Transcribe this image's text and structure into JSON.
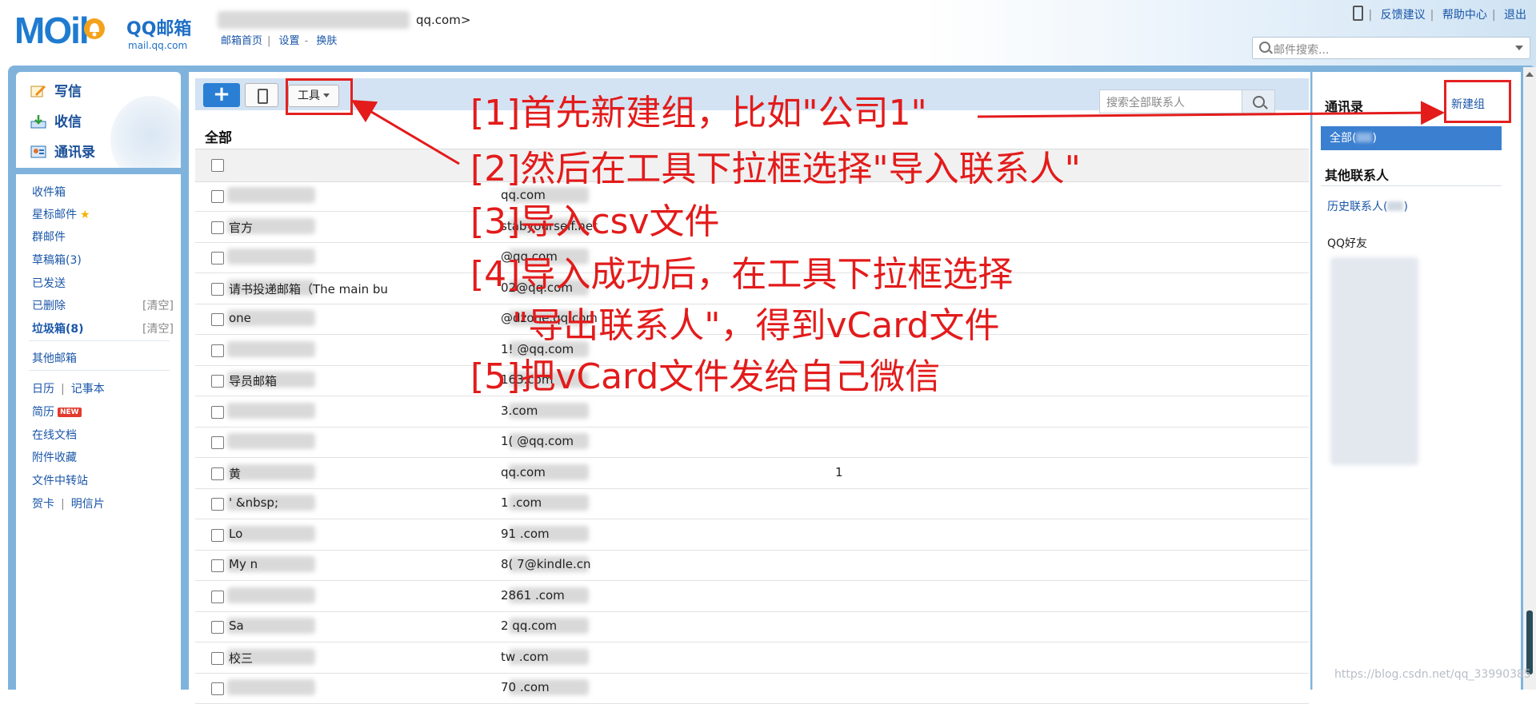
{
  "header": {
    "logo_text": "MOil",
    "brand": "QQ邮箱",
    "brand_url": "mail.qq.com",
    "account_suffix": "qq.com>",
    "links": [
      "邮箱首页",
      "设置",
      "换肤"
    ],
    "right_links": [
      "反馈建议",
      "帮助中心",
      "退出"
    ],
    "mail_search_placeholder": "邮件搜索..."
  },
  "quick_actions": [
    {
      "label": "写信",
      "icon": "compose-icon"
    },
    {
      "label": "收信",
      "icon": "inbox-download-icon"
    },
    {
      "label": "通讯录",
      "icon": "contacts-card-icon"
    }
  ],
  "folders": {
    "inbox": "收件箱",
    "starred": "星标邮件",
    "group": "群邮件",
    "drafts": "草稿箱(3)",
    "sent": "已发送",
    "deleted": "已删除",
    "deleted_clear": "[清空]",
    "spam": "垃圾箱(8)",
    "spam_clear": "[清空]",
    "other": "其他邮箱",
    "calendar": "日历",
    "notes": "记事本",
    "resume": "简历",
    "new_badge": "NEW",
    "docs": "在线文档",
    "attachments": "附件收藏",
    "transfer": "文件中转站",
    "cards": "贺卡",
    "postcards": "明信片"
  },
  "toolbar": {
    "add": "+",
    "tools": "工具",
    "contact_search_placeholder": "搜索全部联系人"
  },
  "list": {
    "title": "全部",
    "rows": [
      {
        "name": "",
        "email": "qq.com",
        "extra": ""
      },
      {
        "name": "官方",
        "email": "stabyourself.net",
        "extra": ""
      },
      {
        "name": "",
        "email": "@qq.com",
        "extra": ""
      },
      {
        "name": "请书投递邮箱（The main bu",
        "email": "02@qq.com",
        "extra": ""
      },
      {
        "name": "one",
        "email": "@dzone.qq.com",
        "extra": ""
      },
      {
        "name": "",
        "email": "1!              @qq.com",
        "extra": ""
      },
      {
        "name": "导员邮箱",
        "email": "163.com",
        "extra": ""
      },
      {
        "name": "",
        "email": "3.com",
        "extra": ""
      },
      {
        "name": "",
        "email": "1(              @qq.com",
        "extra": ""
      },
      {
        "name": "黄",
        "email": "qq.com",
        "extra": "1"
      },
      {
        "name": "'                     &nbsp;",
        "email": "1               .com",
        "extra": ""
      },
      {
        "name": "Lo",
        "email": "91              .com",
        "extra": ""
      },
      {
        "name": "My                  n",
        "email": "8(              7@kindle.cn",
        "extra": ""
      },
      {
        "name": "",
        "email": "2861            .com",
        "extra": ""
      },
      {
        "name": "Sa",
        "email": "2               qq.com",
        "extra": ""
      },
      {
        "name": "校三",
        "email": "tw              .com",
        "extra": ""
      },
      {
        "name": "",
        "email": "70              .com",
        "extra": ""
      }
    ]
  },
  "contacts_panel": {
    "title": "通讯录",
    "new_group": "新建组",
    "all": "全部(",
    "all_suffix": ")",
    "other_contacts": "其他联系人",
    "history": "历史联系人(",
    "history_suffix": ")",
    "qq_friends": "QQ好友"
  },
  "annotations": [
    "[1]首先新建组，比如\"公司1\"",
    "[2]然后在工具下拉框选择\"导入联系人\"",
    "[3]导入csv文件",
    "[4]导入成功后，在工具下拉框选择",
    "\"导出联系人\"，得到vCard文件",
    "[5]把vCard文件发给自己微信"
  ],
  "watermark": "https://blog.csdn.net/qq_33990385",
  "colors": {
    "accent_blue": "#2a7fd4",
    "link_blue": "#1a56a8",
    "annotation_red": "#e31b1b",
    "frame_blue": "#7fb3dc"
  }
}
